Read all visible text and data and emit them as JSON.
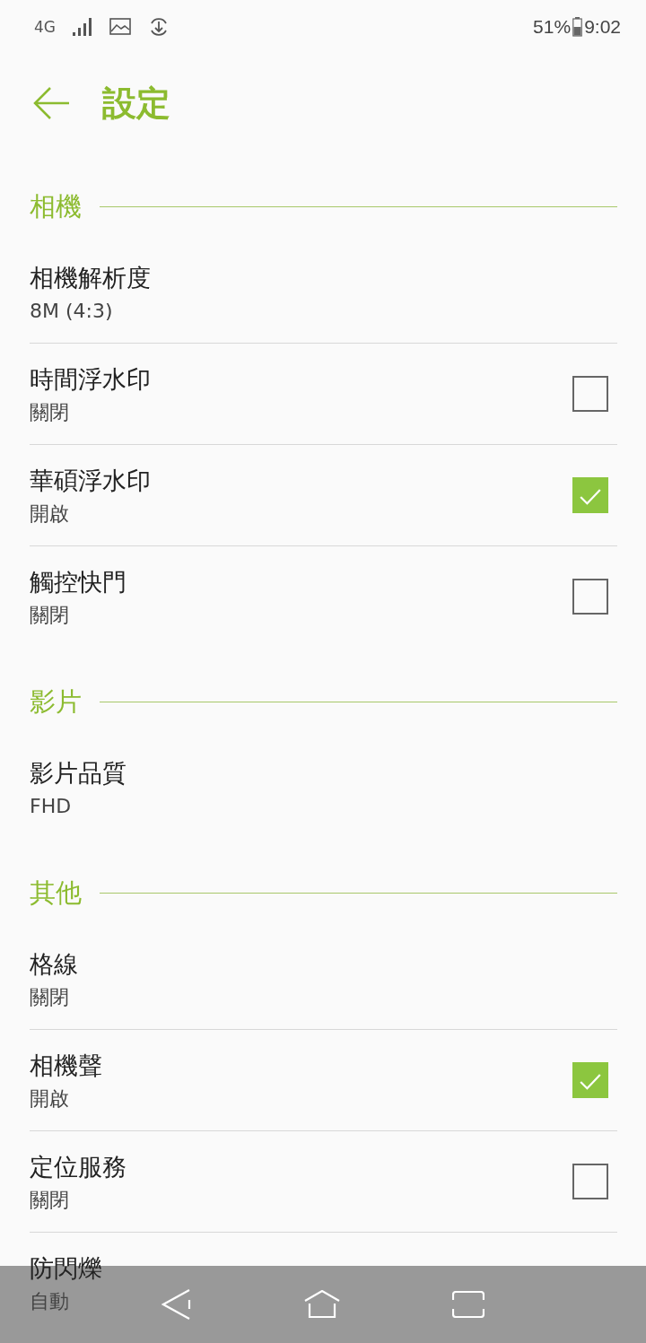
{
  "status_bar": {
    "network": "4G",
    "battery": "51%",
    "time": "9:02"
  },
  "header": {
    "title": "設定"
  },
  "sections": [
    {
      "title": "相機",
      "items": [
        {
          "kind": "value",
          "title": "相機解析度",
          "value": "8M (4:3)"
        },
        {
          "kind": "checkbox",
          "title": "時間浮水印",
          "value": "關閉",
          "checked": false
        },
        {
          "kind": "checkbox",
          "title": "華碩浮水印",
          "value": "開啟",
          "checked": true
        },
        {
          "kind": "checkbox",
          "title": "觸控快門",
          "value": "關閉",
          "checked": false
        }
      ]
    },
    {
      "title": "影片",
      "items": [
        {
          "kind": "value",
          "title": "影片品質",
          "value": "FHD"
        }
      ]
    },
    {
      "title": "其他",
      "items": [
        {
          "kind": "value",
          "title": "格線",
          "value": "關閉"
        },
        {
          "kind": "checkbox",
          "title": "相機聲",
          "value": "開啟",
          "checked": true
        },
        {
          "kind": "checkbox",
          "title": "定位服務",
          "value": "關閉",
          "checked": false
        },
        {
          "kind": "value",
          "title": "防閃爍",
          "value": "自動"
        }
      ]
    }
  ]
}
